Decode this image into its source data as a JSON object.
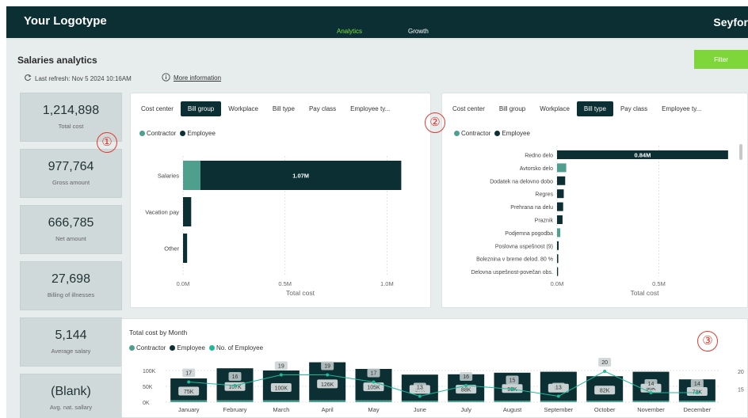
{
  "header": {
    "logo": "Your Logotype",
    "tabs": [
      {
        "label": "Analytics",
        "active": true
      },
      {
        "label": "Growth",
        "active": false
      }
    ],
    "brand": "Seyfor"
  },
  "page": {
    "title": "Salaries analytics",
    "refresh": "Last refresh: Nov 5 2024 10:16AM",
    "more_info": "More information",
    "filter_label": "Filter"
  },
  "kpis": [
    {
      "value": "1,214,898",
      "label": "Total cost"
    },
    {
      "value": "977,764",
      "label": "Gross amount"
    },
    {
      "value": "666,785",
      "label": "Net amount"
    },
    {
      "value": "27,698",
      "label": "Billing of illnesses"
    },
    {
      "value": "5,144",
      "label": "Average salary"
    },
    {
      "value": "(Blank)",
      "label": "Avg. nat. sallary"
    }
  ],
  "markers": [
    "①",
    "②",
    "③"
  ],
  "colors": {
    "contractor": "#4e9f8e",
    "employee": "#0b2f33",
    "count_line": "#1fb99a",
    "accent": "#7fd63a"
  },
  "panel1": {
    "tabs": [
      "Cost center",
      "Bill group",
      "Workplace",
      "Bill type",
      "Pay class",
      "Employee ty..."
    ],
    "selected_tab": 1,
    "legend": [
      "Contractor",
      "Employee"
    ]
  },
  "panel2": {
    "tabs": [
      "Cost center",
      "Bill group",
      "Workplace",
      "Bill type",
      "Pay class",
      "Employee ty..."
    ],
    "selected_tab": 3,
    "legend": [
      "Contractor",
      "Employee"
    ]
  },
  "panel3": {
    "title": "Total cost by Month",
    "legend": [
      "Contractor",
      "Employee",
      "No. of Employee"
    ]
  },
  "chart_data": [
    {
      "type": "bar",
      "orientation": "horizontal",
      "stacked": true,
      "categories": [
        "Salaries",
        "Vacation pay",
        "Other"
      ],
      "series": [
        {
          "name": "Contractor",
          "values": [
            0.085,
            0,
            0
          ]
        },
        {
          "name": "Employee",
          "values": [
            0.985,
            0.04,
            0.02
          ]
        }
      ],
      "data_labels": [
        "1.07M",
        "",
        ""
      ],
      "xlabel": "Total cost",
      "xlim": [
        0,
        1.15
      ],
      "xticks": [
        "0.0M",
        "0.5M",
        "1.0M"
      ],
      "grid": true
    },
    {
      "type": "bar",
      "orientation": "horizontal",
      "stacked": true,
      "categories": [
        "Redno delo",
        "Avtorsko delo",
        "Dodatek na delovno dobo",
        "Regres",
        "Prehrana na delu",
        "Praznik",
        "Podjemna pogodba",
        "Poslovna uspešnost (9)",
        "Boleznina v breme delod. 80 %",
        "Delovna uspešnost-povečan obs."
      ],
      "series": [
        {
          "name": "Contractor",
          "values": [
            0,
            0.045,
            0,
            0,
            0,
            0,
            0.016,
            0,
            0,
            0
          ]
        },
        {
          "name": "Employee",
          "values": [
            0.84,
            0,
            0.04,
            0.033,
            0.03,
            0.027,
            0,
            0.008,
            0.006,
            0.005
          ]
        }
      ],
      "data_labels": [
        "0.84M",
        "",
        "",
        "",
        "",
        "",
        "",
        "",
        "",
        ""
      ],
      "xlabel": "Total cost",
      "xlim": [
        0,
        0.86
      ],
      "xticks": [
        "0.0M",
        "0.5M"
      ],
      "grid": true
    },
    {
      "type": "bar",
      "stacked": true,
      "title": "Total cost by Month",
      "categories": [
        "January",
        "February",
        "March",
        "April",
        "May",
        "June",
        "July",
        "August",
        "September",
        "October",
        "November",
        "December"
      ],
      "series": [
        {
          "name": "Contractor",
          "values": [
            6,
            6,
            6,
            6,
            6,
            5,
            5,
            5,
            5,
            5,
            5,
            5
          ]
        },
        {
          "name": "Employee",
          "values": [
            69,
            101,
            94,
            120,
            99,
            82,
            83,
            88,
            91,
            77,
            91,
            67
          ]
        },
        {
          "name": "No. of Employee",
          "axis": "secondary",
          "values": [
            17,
            16,
            19,
            19,
            17,
            13,
            16,
            15,
            13,
            20,
            14,
            14
          ]
        }
      ],
      "data_labels": [
        "75K",
        "107K",
        "100K",
        "126K",
        "105K",
        "87K",
        "88K",
        "93K",
        "96K",
        "82K",
        "96K",
        "72K"
      ],
      "ylim": [
        0,
        130
      ],
      "yticks": [
        "0K",
        "50K",
        "100K"
      ],
      "y2_ticks": [
        "15",
        "20"
      ],
      "grid": true
    }
  ]
}
